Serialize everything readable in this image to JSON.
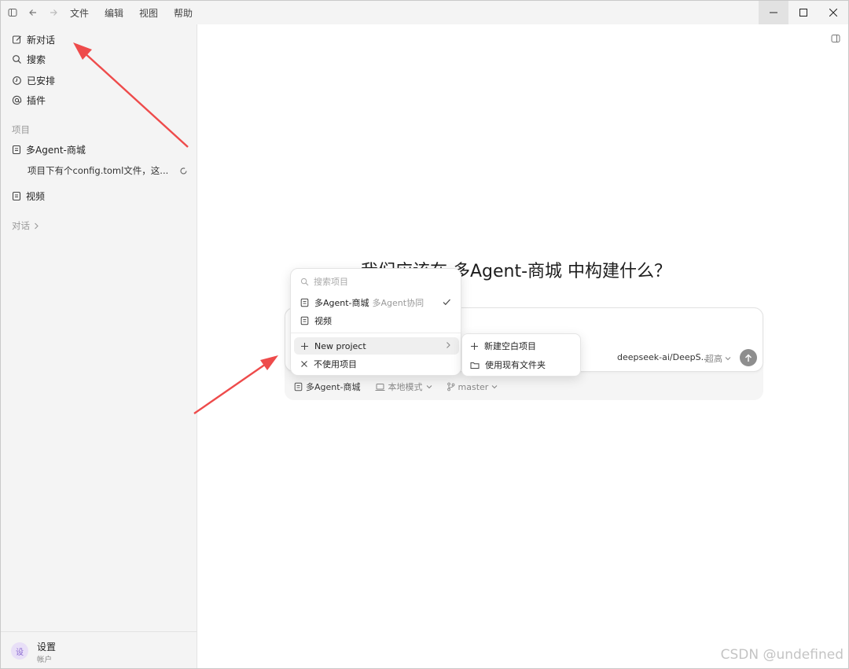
{
  "titlebar": {
    "menu": [
      "文件",
      "编辑",
      "视图",
      "帮助"
    ]
  },
  "sidebar": {
    "nav": [
      {
        "label": "新对话",
        "icon": "edit-icon"
      },
      {
        "label": "搜索",
        "icon": "search-icon"
      },
      {
        "label": "已安排",
        "icon": "clock-icon"
      },
      {
        "label": "插件",
        "icon": "at-icon"
      }
    ],
    "projects_label": "项目",
    "projects": [
      {
        "label": "多Agent-商城"
      },
      {
        "label": "视频"
      }
    ],
    "thread_item": "项目下有个config.toml文件，这...",
    "conversations_label": "对话",
    "settings_title": "设置",
    "settings_sub": "帐户",
    "avatar_text": "设"
  },
  "main": {
    "headline": "我们应该在 多Agent-商城 中构建什么？",
    "model": "deepseek-ai/DeepS...",
    "effort": "超高",
    "footer": {
      "project": "多Agent-商城",
      "mode": "本地模式",
      "branch": "master"
    }
  },
  "dropdown": {
    "search_placeholder": "搜索项目",
    "items": [
      {
        "label": "多Agent-商城",
        "hint": "多Agent协同"
      },
      {
        "label": "视频"
      }
    ],
    "new_project": "New project",
    "no_project": "不使用项目"
  },
  "submenu": {
    "items": [
      "新建空白项目",
      "使用现有文件夹"
    ]
  },
  "watermark": "CSDN @undefined",
  "colors": {
    "arrow": "#ee4b4b",
    "sidebar_bg": "#f4f4f4",
    "send_button": "#8e8e8e"
  }
}
